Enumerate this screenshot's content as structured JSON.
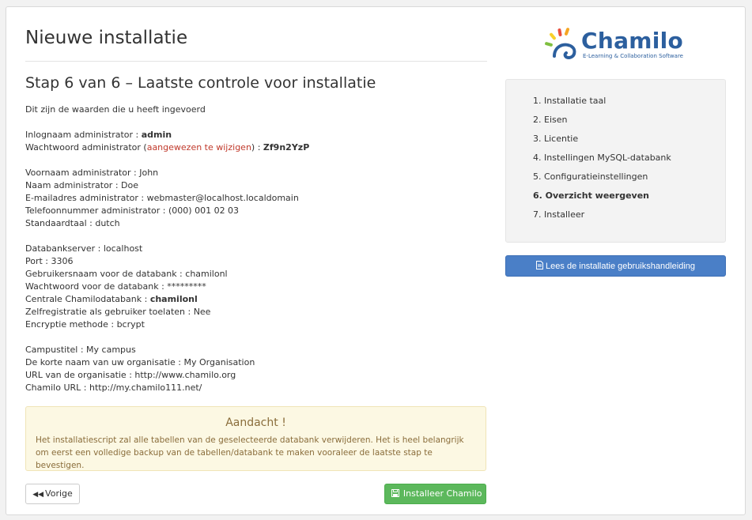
{
  "header": {
    "title": "Nieuwe installatie"
  },
  "step": {
    "title": "Stap 6 van 6 – Laatste controle voor installatie",
    "intro": "Dit zijn de waarden die u heeft ingevoerd"
  },
  "admin": {
    "login_label": "Inlognaam administrator : ",
    "login_value": "admin",
    "password_label": "Wachtwoord administrator (",
    "password_note": "aangewezen te wijzigen",
    "password_label_end": ") : ",
    "password_value": "Zf9n2YzP",
    "firstname": "Voornaam administrator : John",
    "lastname": "Naam administrator : Doe",
    "email": "E-mailadres administrator : webmaster@localhost.localdomain",
    "phone": "Telefoonnummer administrator : (000) 001 02 03",
    "language": "Standaardtaal : dutch"
  },
  "database": {
    "server": "Databankserver : localhost",
    "port": "Port : 3306",
    "user": "Gebruikersnaam voor de databank : chamilonl",
    "password": "Wachtwoord voor de databank : *********",
    "main_db_label": "Centrale Chamilodatabank : ",
    "main_db_value": "chamilonl",
    "self_registration": "Zelfregistratie als gebruiker toelaten : Nee",
    "encryption": "Encryptie methode : bcrypt"
  },
  "campus": {
    "title": "Campustitel : My campus",
    "org_short": "De korte naam van uw organisatie : My Organisation",
    "org_url": "URL van de organisatie : http://www.chamilo.org",
    "chamilo_url": "Chamilo URL : http://my.chamilo111.net/"
  },
  "alert": {
    "title": "Aandacht !",
    "text": "Het installatiescript zal alle tabellen van de geselecteerde databank verwijderen. Het is heel belangrijk om eerst een volledige backup van de tabellen/databank te maken vooraleer de laatste stap te bevestigen."
  },
  "buttons": {
    "previous": "Vorige",
    "install": "Installeer Chamilo",
    "manual": "Lees de installatie gebruikshandleiding"
  },
  "logo": {
    "name": "Chamilo",
    "tagline": "E-Learning & Collaboration Software"
  },
  "steps": [
    {
      "label": "1. Installatie taal",
      "active": false
    },
    {
      "label": "2. Eisen",
      "active": false
    },
    {
      "label": "3. Licentie",
      "active": false
    },
    {
      "label": "4. Instellingen MySQL-databank",
      "active": false
    },
    {
      "label": "5. Configuratieinstellingen",
      "active": false
    },
    {
      "label": "6. Overzicht weergeven",
      "active": true
    },
    {
      "label": "7. Installeer",
      "active": false
    }
  ],
  "colors": {
    "accent_blue": "#4a7fc7",
    "install_green": "#5cb85c",
    "warning_text": "#c0392b",
    "alert_bg": "#fcf8e3"
  },
  "icons": {
    "previous": "backward-icon",
    "install": "save-icon",
    "manual": "document-icon"
  }
}
